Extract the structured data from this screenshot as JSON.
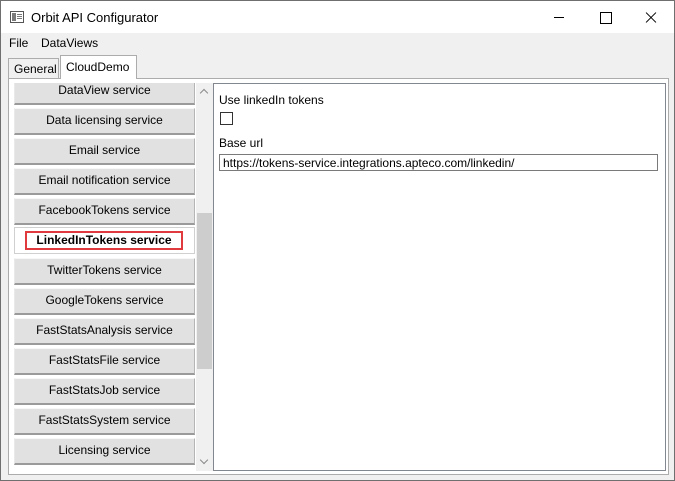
{
  "window": {
    "title": "Orbit API Configurator",
    "controls": [
      "minimize",
      "maximize",
      "close"
    ]
  },
  "menu": {
    "items": [
      "File",
      "DataViews"
    ]
  },
  "tabs": [
    {
      "label": "General",
      "selected": false
    },
    {
      "label": "CloudDemo",
      "selected": true
    }
  ],
  "services": [
    {
      "label": "DataView service"
    },
    {
      "label": "Data licensing service"
    },
    {
      "label": "Email service"
    },
    {
      "label": "Email notification service"
    },
    {
      "label": "FacebookTokens service"
    },
    {
      "label": "LinkedInTokens service",
      "selected": true
    },
    {
      "label": "TwitterTokens service"
    },
    {
      "label": "GoogleTokens service"
    },
    {
      "label": "FastStatsAnalysis service"
    },
    {
      "label": "FastStatsFile service"
    },
    {
      "label": "FastStatsJob service"
    },
    {
      "label": "FastStatsSystem service"
    },
    {
      "label": "Licensing service"
    }
  ],
  "settings": {
    "use_tokens_label": "Use linkedIn tokens",
    "use_tokens_checked": false,
    "base_url_label": "Base url",
    "base_url_value": "https://tokens-service.integrations.apteco.com/linkedin/"
  },
  "colors": {
    "selection_highlight": "#e0393e",
    "button_face": "#e1e1e1",
    "window_bg": "#f0f0f0"
  }
}
